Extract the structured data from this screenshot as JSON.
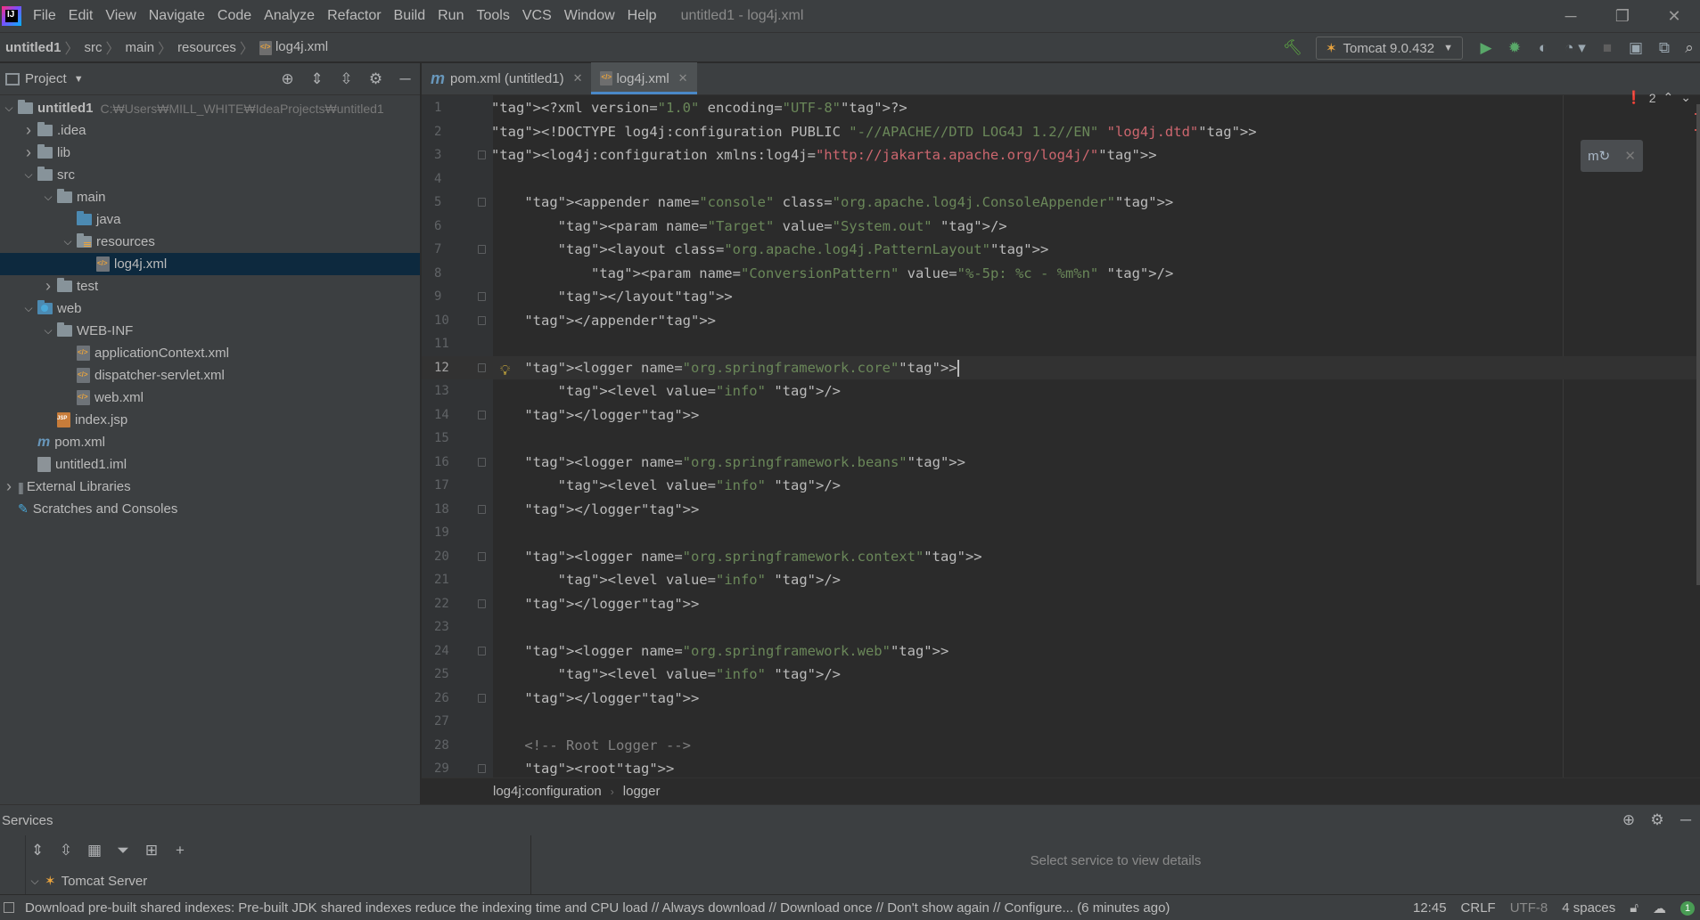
{
  "menubar": {
    "items": [
      "File",
      "Edit",
      "View",
      "Navigate",
      "Code",
      "Analyze",
      "Refactor",
      "Build",
      "Run",
      "Tools",
      "VCS",
      "Window",
      "Help"
    ],
    "window_title": "untitled1 - log4j.xml"
  },
  "navbar": {
    "breadcrumbs": [
      "untitled1",
      "src",
      "main",
      "resources",
      "log4j.xml"
    ],
    "run_config": "Tomcat 9.0.432"
  },
  "project": {
    "header_title": "Project",
    "tree": [
      {
        "label": "untitled1",
        "hint": "C:₩Users₩MILL_WHITE₩IdeaProjects₩untitled1",
        "icon": "folder-icon",
        "depth": 0,
        "expanded": true
      },
      {
        "label": ".idea",
        "icon": "folder-icon",
        "depth": 1,
        "expanded": false
      },
      {
        "label": "lib",
        "icon": "folder-icon",
        "depth": 1,
        "expanded": false
      },
      {
        "label": "src",
        "icon": "folder-icon",
        "depth": 1,
        "expanded": true
      },
      {
        "label": "main",
        "icon": "folder-icon",
        "depth": 2,
        "expanded": true
      },
      {
        "label": "java",
        "icon": "source-folder-icon",
        "depth": 3
      },
      {
        "label": "resources",
        "icon": "resources-folder-icon",
        "depth": 3,
        "expanded": true
      },
      {
        "label": "log4j.xml",
        "icon": "xml-file-icon",
        "depth": 4,
        "selected": true
      },
      {
        "label": "test",
        "icon": "folder-icon",
        "depth": 2,
        "expanded": false
      },
      {
        "label": "web",
        "icon": "web-folder-icon",
        "depth": 1,
        "expanded": true
      },
      {
        "label": "WEB-INF",
        "icon": "folder-icon",
        "depth": 2,
        "expanded": true
      },
      {
        "label": "applicationContext.xml",
        "icon": "xml-file-icon",
        "depth": 3
      },
      {
        "label": "dispatcher-servlet.xml",
        "icon": "xml-file-icon",
        "depth": 3
      },
      {
        "label": "web.xml",
        "icon": "xml-file-icon",
        "depth": 3
      },
      {
        "label": "index.jsp",
        "icon": "jsp-file-icon",
        "depth": 2
      },
      {
        "label": "pom.xml",
        "icon": "maven-icon",
        "depth": 1
      },
      {
        "label": "untitled1.iml",
        "icon": "iml-file-icon",
        "depth": 1
      },
      {
        "label": "External Libraries",
        "icon": "library-icon",
        "depth": 0,
        "expanded": false
      },
      {
        "label": "Scratches and Consoles",
        "icon": "scratch-icon",
        "depth": 0
      }
    ]
  },
  "editor": {
    "tabs": [
      {
        "label": "pom.xml (untitled1)",
        "icon": "maven-icon",
        "active": false
      },
      {
        "label": "log4j.xml",
        "icon": "xml-file-icon",
        "active": true
      }
    ],
    "error_count": "2",
    "current_line": 12,
    "lines": [
      "<?xml version=\"1.0\" encoding=\"UTF-8\"?>",
      "<!DOCTYPE log4j:configuration PUBLIC \"-//APACHE//DTD LOG4J 1.2//EN\" \"log4j.dtd\">",
      "<log4j:configuration xmlns:log4j=\"http://jakarta.apache.org/log4j/\">",
      "",
      "    <appender name=\"console\" class=\"org.apache.log4j.ConsoleAppender\">",
      "        <param name=\"Target\" value=\"System.out\" />",
      "        <layout class=\"org.apache.log4j.PatternLayout\">",
      "            <param name=\"ConversionPattern\" value=\"%-5p: %c - %m%n\" />",
      "        </layout>",
      "    </appender>",
      "",
      "    <logger name=\"org.springframework.core\">",
      "        <level value=\"info\" />",
      "    </logger>",
      "",
      "    <logger name=\"org.springframework.beans\">",
      "        <level value=\"info\" />",
      "    </logger>",
      "",
      "    <logger name=\"org.springframework.context\">",
      "        <level value=\"info\" />",
      "    </logger>",
      "",
      "    <logger name=\"org.springframework.web\">",
      "        <level value=\"info\" />",
      "    </logger>",
      "",
      "    <!-- Root Logger -->",
      "    <root>"
    ],
    "breadcrumb": [
      "log4j:configuration",
      "logger"
    ]
  },
  "services": {
    "title": "Services",
    "tree_item": "Tomcat Server",
    "detail_placeholder": "Select service to view details"
  },
  "statusbar": {
    "message": "Download pre-built shared indexes: Pre-built JDK shared indexes reduce the indexing time and CPU load // Always download // Download once // Don't show again // Configure... (6 minutes ago)",
    "position": "12:45",
    "line_separator": "CRLF",
    "encoding": "UTF-8",
    "indent": "4 spaces",
    "notification_count": "1"
  }
}
